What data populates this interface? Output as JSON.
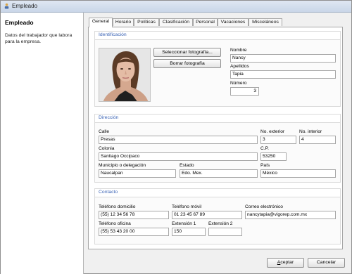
{
  "window": {
    "title": "Empleado"
  },
  "sidebar": {
    "heading": "Empleado",
    "description": "Datos del trabajador que labora para la empresa."
  },
  "tabs": [
    {
      "label": "General"
    },
    {
      "label": "Horario"
    },
    {
      "label": "Políticas"
    },
    {
      "label": "Clasificación"
    },
    {
      "label": "Personal"
    },
    {
      "label": "Vacaciones"
    },
    {
      "label": "Misceláneos"
    }
  ],
  "identificacion": {
    "title": "Identificación",
    "select_photo": "Seleccionar fotografía...",
    "delete_photo": "Borrar fotografía",
    "nombre_label": "Nombre",
    "nombre_value": "Nancy",
    "apellidos_label": "Apellidos",
    "apellidos_value": "Tapia",
    "numero_label": "Número",
    "numero_value": "3"
  },
  "direccion": {
    "title": "Dirección",
    "calle_label": "Calle",
    "calle_value": "Presas",
    "no_ext_label": "No. exterior",
    "no_ext_value": "3",
    "no_int_label": "No. interior",
    "no_int_value": "4",
    "colonia_label": "Colonia",
    "colonia_value": "Santiago Occipaco",
    "cp_label": "C.P.",
    "cp_value": "53250",
    "municipio_label": "Municipio o delegación",
    "municipio_value": "Naucalpan",
    "estado_label": "Estado",
    "estado_value": "Edo. Mex.",
    "pais_label": "País",
    "pais_value": "México"
  },
  "contacto": {
    "title": "Contacto",
    "tel_dom_label": "Teléfono domicilio",
    "tel_dom_value": "(55) 12 34 56 78",
    "tel_movil_label": "Teléfono móvil",
    "tel_movil_value": "01 23 45 67 89",
    "email_label": "Correo electrónico",
    "email_value": "nancytapia@vigorep.com.mx",
    "tel_ofi_label": "Teléfono oficina",
    "tel_ofi_value": "(55) 53 43 20 00",
    "ext1_label": "Extensión 1",
    "ext1_value": "150",
    "ext2_label": "Extensión 2",
    "ext2_value": ""
  },
  "footer": {
    "accept_prefix": "A",
    "accept_rest": "ceptar",
    "cancel_label": "Cancelar"
  },
  "icons": {
    "title": "app-employee-icon"
  }
}
